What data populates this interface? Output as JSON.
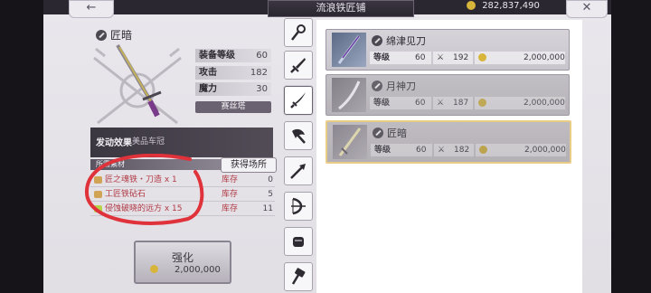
{
  "header": {
    "back_icon": "←",
    "title": "流浪铁匠铺",
    "currency": "282,837,490",
    "close_icon": "✕"
  },
  "weapon": {
    "name": "匠暗",
    "stats": [
      {
        "label": "装备等级",
        "value": "60"
      },
      {
        "label": "攻击",
        "value": "182"
      },
      {
        "label": "魔力",
        "value": "30"
      }
    ],
    "tag": "赛丝塔"
  },
  "effect": {
    "label": "发动效果",
    "desc": "美品车冠"
  },
  "materials": {
    "header": "所需素材",
    "acquire_label": "获得场所",
    "items": [
      {
        "name": "匠之魂铁・刀造 x 1",
        "stock_label": "库存",
        "stock": "0"
      },
      {
        "name": "工匠铁砧石",
        "stock_label": "库存",
        "stock": "5"
      },
      {
        "name": "侵蚀破晓的远方 x 15",
        "stock_label": "库存",
        "stock": "11"
      }
    ]
  },
  "enhance": {
    "label": "强化",
    "cost": "2,000,000"
  },
  "tabs": [
    "staff-icon",
    "knife-icon",
    "sword-icon",
    "axe-icon",
    "spear-icon",
    "bow-icon",
    "fist-icon",
    "hammer-icon"
  ],
  "list": [
    {
      "name": "绵津见刀",
      "level_label": "等级",
      "level": "60",
      "attack": "192",
      "price": "2,000,000",
      "state": "normal"
    },
    {
      "name": "月神刀",
      "level_label": "等级",
      "level": "60",
      "attack": "187",
      "price": "2,000,000",
      "state": "disabled"
    },
    {
      "name": "匠暗",
      "level_label": "等级",
      "level": "60",
      "attack": "182",
      "price": "2,000,000",
      "state": "selected"
    }
  ],
  "colors": {
    "accent_red": "#e0323a",
    "coin": "#d7b43a",
    "selected_border": "#e7c77a"
  }
}
